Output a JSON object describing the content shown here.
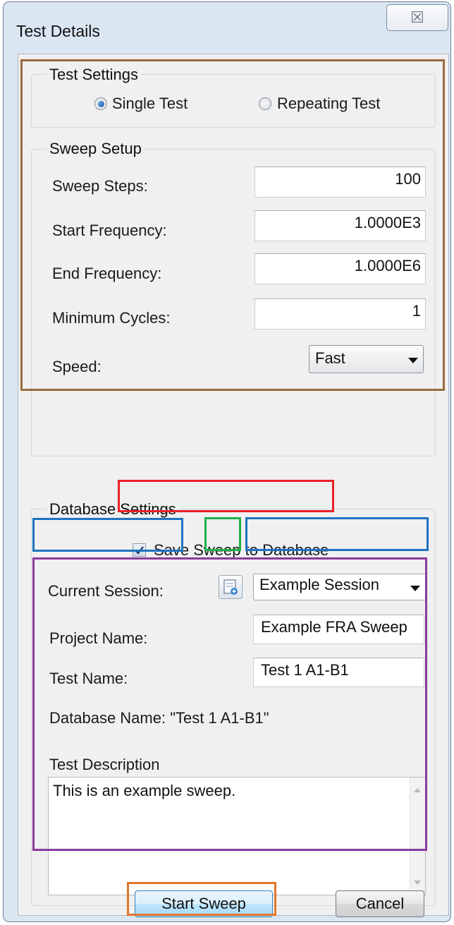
{
  "window": {
    "title": "Test Details",
    "close_glyph": "☒"
  },
  "test_settings": {
    "legend": "Test Settings",
    "options": [
      {
        "label": "Single Test",
        "selected": true
      },
      {
        "label": "Repeating Test",
        "selected": false
      }
    ]
  },
  "sweep_setup": {
    "legend": "Sweep Setup",
    "fields": [
      {
        "label": "Sweep Steps:",
        "value": "100"
      },
      {
        "label": "Start Frequency:",
        "value": "1.0000E3"
      },
      {
        "label": "End Frequency:",
        "value": "1.0000E6"
      },
      {
        "label": "Minimum Cycles:",
        "value": "1"
      }
    ],
    "speed_label": "Speed:",
    "speed_value": "Fast"
  },
  "database_settings": {
    "legend": "Database Settings",
    "save_checkbox_label": "Save Sweep to Database",
    "save_checked": true,
    "current_session_label": "Current Session:",
    "session_value": "Example Session",
    "project_name_label": "Project Name:",
    "project_name_value": "Example FRA Sweep",
    "test_name_label": "Test Name:",
    "test_name_value": "Test 1 A1-B1",
    "database_name_text": "Database Name: \"Test 1 A1-B1\"",
    "test_description_label": "Test Description",
    "test_description_value": "This is an example sweep."
  },
  "buttons": {
    "start_sweep": "Start Sweep",
    "cancel": "Cancel"
  },
  "colors": {
    "highlight_sweep": "#9a6a3c",
    "highlight_save": "#e8202a",
    "highlight_session": "#1e73c0",
    "highlight_icon": "#1fb04a",
    "highlight_details": "#8a3a9e",
    "highlight_start": "#e2762a"
  }
}
